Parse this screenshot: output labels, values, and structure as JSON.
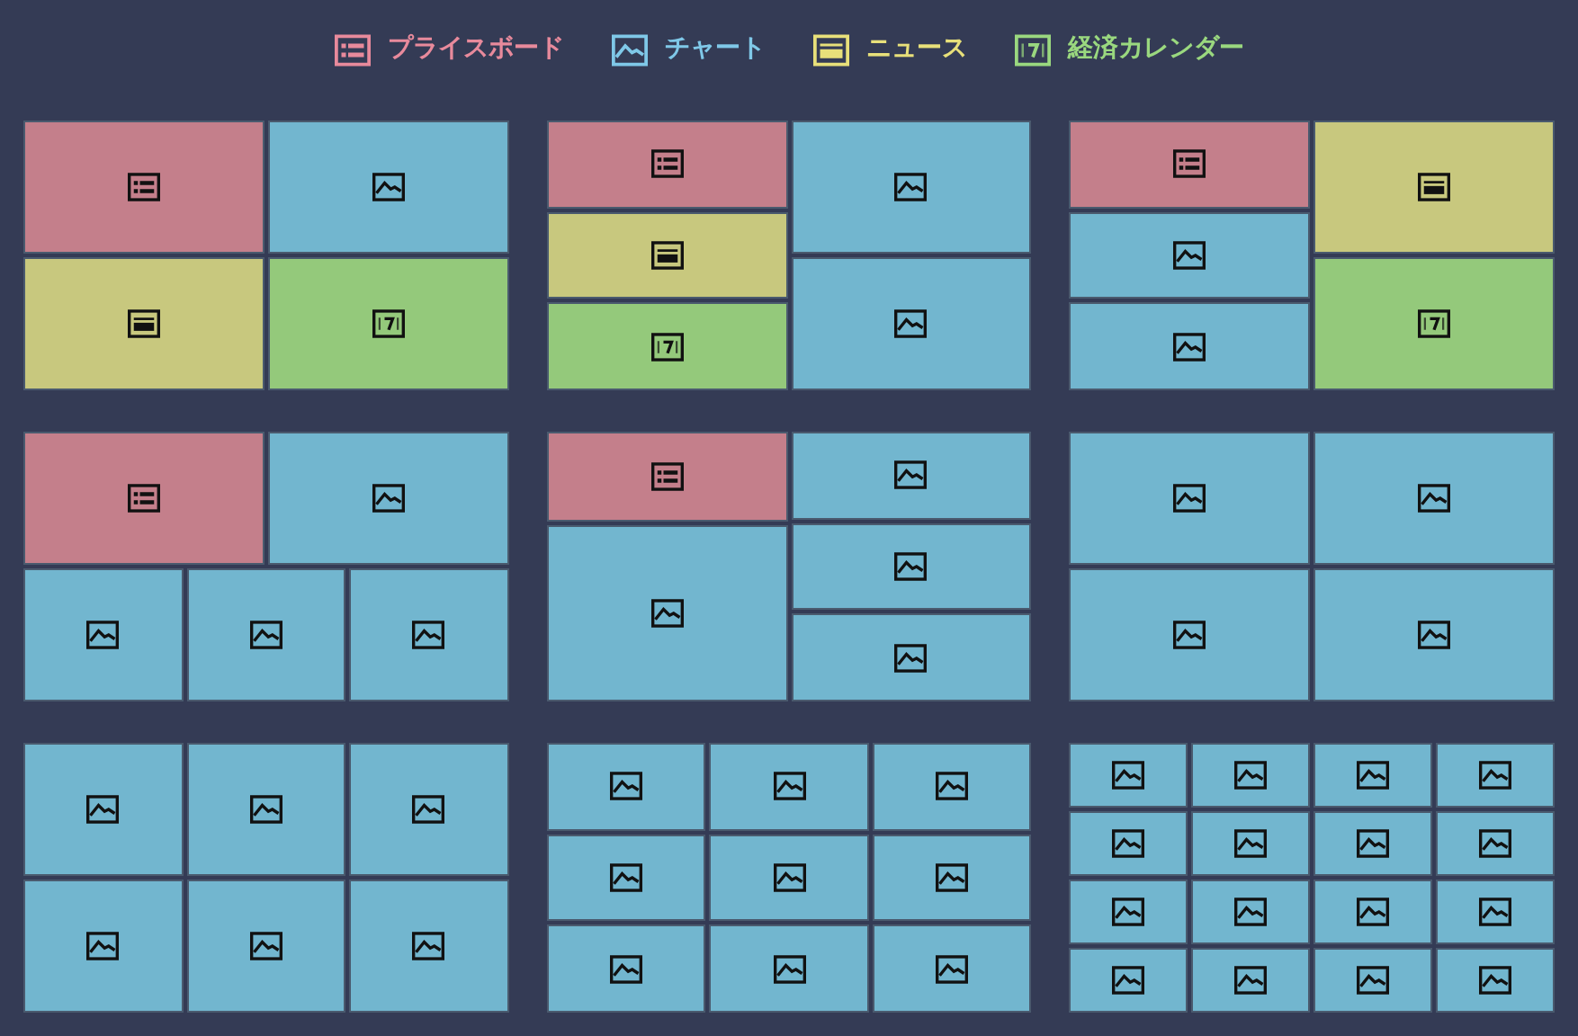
{
  "legend": [
    {
      "kind": "priceboard",
      "label": "プライスボード"
    },
    {
      "kind": "chart",
      "label": "チャート"
    },
    {
      "kind": "news",
      "label": "ニュース"
    },
    {
      "kind": "calendar",
      "label": "経済カレンダー"
    }
  ],
  "layouts": [
    {
      "kind": "rows",
      "children": [
        {
          "kind": "cols",
          "children": [
            {
              "kind": "priceboard"
            },
            {
              "kind": "chart"
            }
          ]
        },
        {
          "kind": "cols",
          "children": [
            {
              "kind": "news"
            },
            {
              "kind": "calendar"
            }
          ]
        }
      ]
    },
    {
      "kind": "cols",
      "children": [
        {
          "kind": "rows",
          "children": [
            {
              "kind": "priceboard"
            },
            {
              "kind": "news"
            },
            {
              "kind": "calendar"
            }
          ]
        },
        {
          "kind": "rows",
          "children": [
            {
              "kind": "chart"
            },
            {
              "kind": "chart"
            }
          ]
        }
      ]
    },
    {
      "kind": "cols",
      "children": [
        {
          "kind": "rows",
          "children": [
            {
              "kind": "priceboard"
            },
            {
              "kind": "chart"
            },
            {
              "kind": "chart"
            }
          ]
        },
        {
          "kind": "rows",
          "children": [
            {
              "kind": "news"
            },
            {
              "kind": "calendar"
            }
          ]
        }
      ]
    },
    {
      "kind": "rows",
      "children": [
        {
          "kind": "cols",
          "children": [
            {
              "kind": "priceboard"
            },
            {
              "kind": "chart"
            }
          ]
        },
        {
          "kind": "cols",
          "children": [
            {
              "kind": "chart"
            },
            {
              "kind": "chart"
            },
            {
              "kind": "chart"
            }
          ]
        }
      ]
    },
    {
      "kind": "cols",
      "children": [
        {
          "kind": "rows",
          "children": [
            {
              "kind": "priceboard",
              "tall": false
            },
            {
              "kind": "chart",
              "tall": true
            }
          ]
        },
        {
          "kind": "rows",
          "children": [
            {
              "kind": "chart"
            },
            {
              "kind": "chart"
            },
            {
              "kind": "chart"
            }
          ]
        }
      ]
    },
    {
      "kind": "rows",
      "children": [
        {
          "kind": "cols",
          "children": [
            {
              "kind": "chart"
            },
            {
              "kind": "chart"
            }
          ]
        },
        {
          "kind": "cols",
          "children": [
            {
              "kind": "chart"
            },
            {
              "kind": "chart"
            }
          ]
        }
      ]
    },
    {
      "kind": "rows",
      "children": [
        {
          "kind": "cols",
          "children": [
            {
              "kind": "chart"
            },
            {
              "kind": "chart"
            },
            {
              "kind": "chart"
            }
          ]
        },
        {
          "kind": "cols",
          "children": [
            {
              "kind": "chart"
            },
            {
              "kind": "chart"
            },
            {
              "kind": "chart"
            }
          ]
        }
      ]
    },
    {
      "kind": "rows",
      "children": [
        {
          "kind": "cols",
          "children": [
            {
              "kind": "chart"
            },
            {
              "kind": "chart"
            },
            {
              "kind": "chart"
            }
          ]
        },
        {
          "kind": "cols",
          "children": [
            {
              "kind": "chart"
            },
            {
              "kind": "chart"
            },
            {
              "kind": "chart"
            }
          ]
        },
        {
          "kind": "cols",
          "children": [
            {
              "kind": "chart"
            },
            {
              "kind": "chart"
            },
            {
              "kind": "chart"
            }
          ]
        }
      ]
    },
    {
      "kind": "rows",
      "children": [
        {
          "kind": "cols",
          "children": [
            {
              "kind": "chart"
            },
            {
              "kind": "chart"
            },
            {
              "kind": "chart"
            },
            {
              "kind": "chart"
            }
          ]
        },
        {
          "kind": "cols",
          "children": [
            {
              "kind": "chart"
            },
            {
              "kind": "chart"
            },
            {
              "kind": "chart"
            },
            {
              "kind": "chart"
            }
          ]
        },
        {
          "kind": "cols",
          "children": [
            {
              "kind": "chart"
            },
            {
              "kind": "chart"
            },
            {
              "kind": "chart"
            },
            {
              "kind": "chart"
            }
          ]
        },
        {
          "kind": "cols",
          "children": [
            {
              "kind": "chart"
            },
            {
              "kind": "chart"
            },
            {
              "kind": "chart"
            },
            {
              "kind": "chart"
            }
          ]
        }
      ]
    }
  ]
}
